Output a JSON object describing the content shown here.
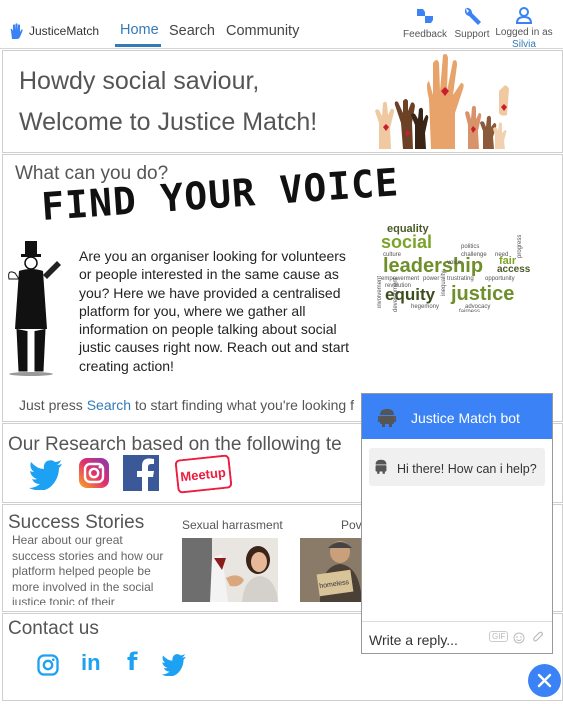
{
  "nav": {
    "brand": "JusticeMatch",
    "links": [
      "Home",
      "Search",
      "Community"
    ],
    "tools": {
      "feedback": "Feedback",
      "support": "Support",
      "logged_in_as": "Logged in as",
      "user": "Silvia"
    },
    "accent": "#337ab7"
  },
  "welcome": {
    "line1": "Howdy social saviour,",
    "line2": "Welcome to Justice Match!"
  },
  "what": {
    "title": "What can you do?",
    "banner": "FIND YOUR VOICE",
    "body": "Are you an organiser looking for volunteers or people interested in the same cause as you? Here we have provided a centralised platform for you, where we gather all information on people talking about social justic causes right now. Reach out and start creating action!",
    "press_pre": "Just press ",
    "press_link": "Search",
    "press_post": " to start finding what you're looking f",
    "wordcloud": {
      "big": [
        "social",
        "leadership",
        "equity",
        "justice"
      ],
      "small": [
        "equality",
        "culture",
        "empowerment",
        "power",
        "revolution",
        "hegemony",
        "politics",
        "challenge",
        "voice",
        "trustrating",
        "fair",
        "access",
        "need",
        "opportunity",
        "advocacy",
        "fairness",
        "involvement",
        "inequality",
        "development",
        "progress"
      ]
    }
  },
  "research": {
    "title": "Our Research based on the following te",
    "logos": [
      "twitter",
      "instagram",
      "facebook",
      "meetup"
    ],
    "meetup_label": "Meetup"
  },
  "stories": {
    "title": "Success Stories",
    "text": "Hear about our great success stories and how our platform helped people be more involved in the social justice topic of their",
    "items": [
      {
        "caption": "Sexual harrasment"
      },
      {
        "caption": "Pov",
        "sign": "homeless"
      }
    ]
  },
  "contact": {
    "title": "Contact us",
    "icons": [
      "instagram",
      "linkedin",
      "facebook",
      "twitter"
    ],
    "linkedin_label": "in",
    "facebook_label": "f"
  },
  "chat": {
    "title": "Justice Match bot",
    "message": "Hi there! How can i help?",
    "placeholder": "Write a reply...",
    "gif_label": "GIF",
    "color": "#3b82f6"
  }
}
